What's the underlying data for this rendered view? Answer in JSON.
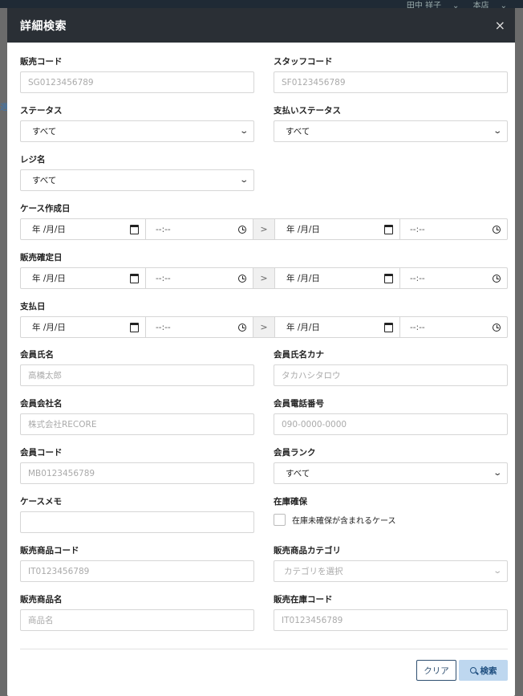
{
  "background": {
    "user_name": "田中 祥子",
    "store_name": "本店",
    "tab_fragment": "選"
  },
  "modal": {
    "title": "詳細検索",
    "close_glyph": "×",
    "fields": {
      "sales_code": {
        "label": "販売コード",
        "placeholder": "SG0123456789"
      },
      "staff_code": {
        "label": "スタッフコード",
        "placeholder": "SF0123456789"
      },
      "status": {
        "label": "ステータス",
        "value": "すべて"
      },
      "payment_status": {
        "label": "支払いステータス",
        "value": "すべて"
      },
      "register_name": {
        "label": "レジ名",
        "value": "すべて"
      },
      "case_created_date": {
        "label": "ケース作成日"
      },
      "sale_confirmed_date": {
        "label": "販売確定日"
      },
      "payment_date": {
        "label": "支払日"
      },
      "member_name": {
        "label": "会員氏名",
        "placeholder": "高橋太郎"
      },
      "member_name_kana": {
        "label": "会員氏名カナ",
        "placeholder": "タカハシタロウ"
      },
      "member_company": {
        "label": "会員会社名",
        "placeholder": "株式会社RECORE"
      },
      "member_phone": {
        "label": "会員電話番号",
        "placeholder": "090-0000-0000"
      },
      "member_code": {
        "label": "会員コード",
        "placeholder": "MB0123456789"
      },
      "member_rank": {
        "label": "会員ランク",
        "value": "すべて"
      },
      "case_memo": {
        "label": "ケースメモ",
        "placeholder": ""
      },
      "stock_reserve": {
        "label": "在庫確保",
        "checkbox_label": "在庫未確保が含まれるケース"
      },
      "sales_item_code": {
        "label": "販売商品コード",
        "placeholder": "IT0123456789"
      },
      "sales_item_category": {
        "label": "販売商品カテゴリ",
        "placeholder": "カテゴリを選択"
      },
      "sales_item_name": {
        "label": "販売商品名",
        "placeholder": "商品名"
      },
      "sales_stock_code": {
        "label": "販売在庫コード",
        "placeholder": "IT0123456789"
      }
    },
    "date_placeholder": "年 /月/日",
    "time_placeholder": "--:--",
    "range_separator": ">",
    "buttons": {
      "clear": "クリア",
      "search": "検索"
    }
  }
}
